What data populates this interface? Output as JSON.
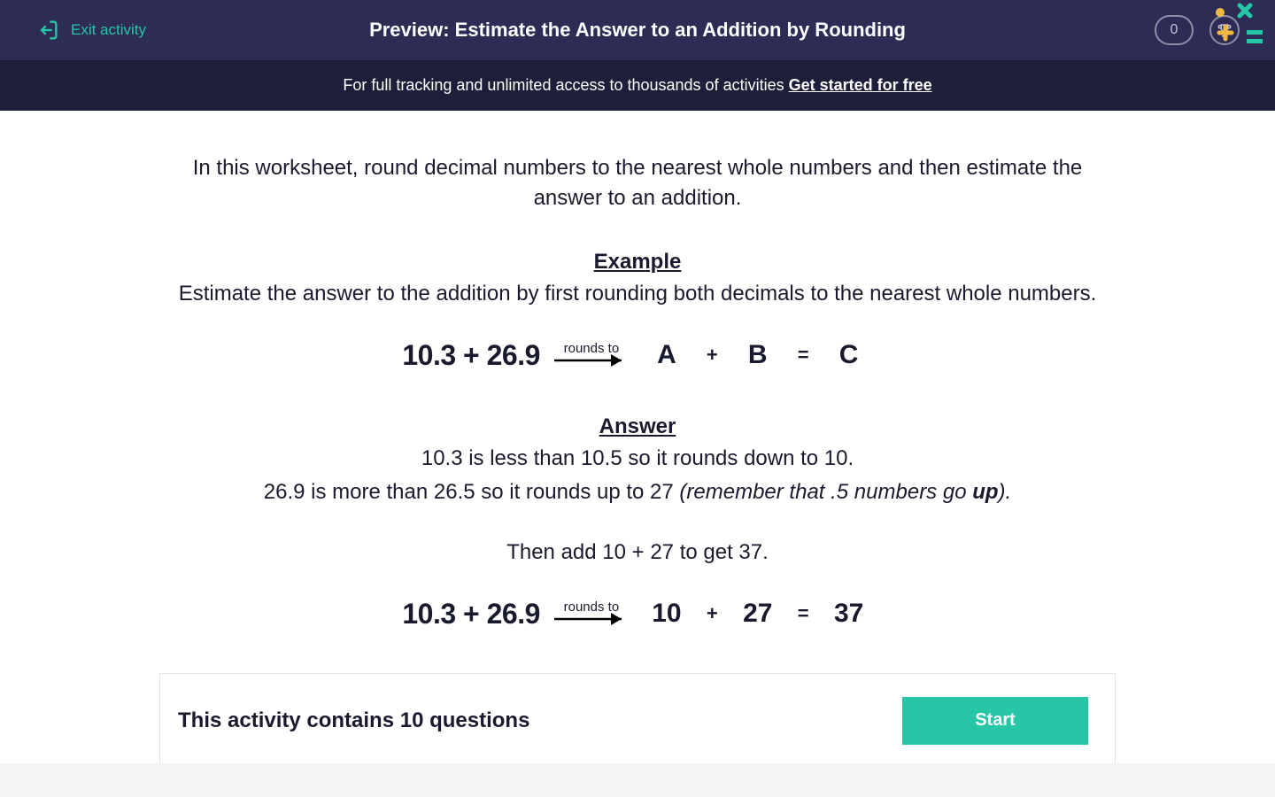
{
  "header": {
    "exit_label": "Exit activity",
    "title": "Preview: Estimate the Answer to an Addition by Rounding",
    "score": "0"
  },
  "banner": {
    "text": "For full tracking and unlimited access to thousands of activities ",
    "cta": "Get started for free"
  },
  "intro": "In this worksheet, round decimal numbers to the nearest whole numbers and then estimate the answer to an addition.",
  "example": {
    "label": "Example",
    "prompt": "Estimate the answer to the addition by first rounding both decimals to the nearest whole numbers.",
    "lhs": "10.3 + 26.9",
    "rounds_label": "rounds to",
    "a": "A",
    "b": "B",
    "c": "C",
    "plus": "+",
    "eq": "="
  },
  "answer": {
    "label": "Answer",
    "line1": "10.3 is less than 10.5 so it rounds down to 10.",
    "line2_pre": "26.9 is more than 26.5 so it rounds up to 27 ",
    "line2_note_pre": "(remember that .5 numbers go ",
    "line2_up": "up",
    "line2_note_post": ").",
    "line3": "Then add 10 + 27 to get 37.",
    "lhs": "10.3 + 26.9",
    "rounds_label": "rounds to",
    "a": "10",
    "b": "27",
    "c": "37",
    "plus": "+",
    "eq": "="
  },
  "footer": {
    "text": "This activity contains 10 questions",
    "start": "Start"
  }
}
